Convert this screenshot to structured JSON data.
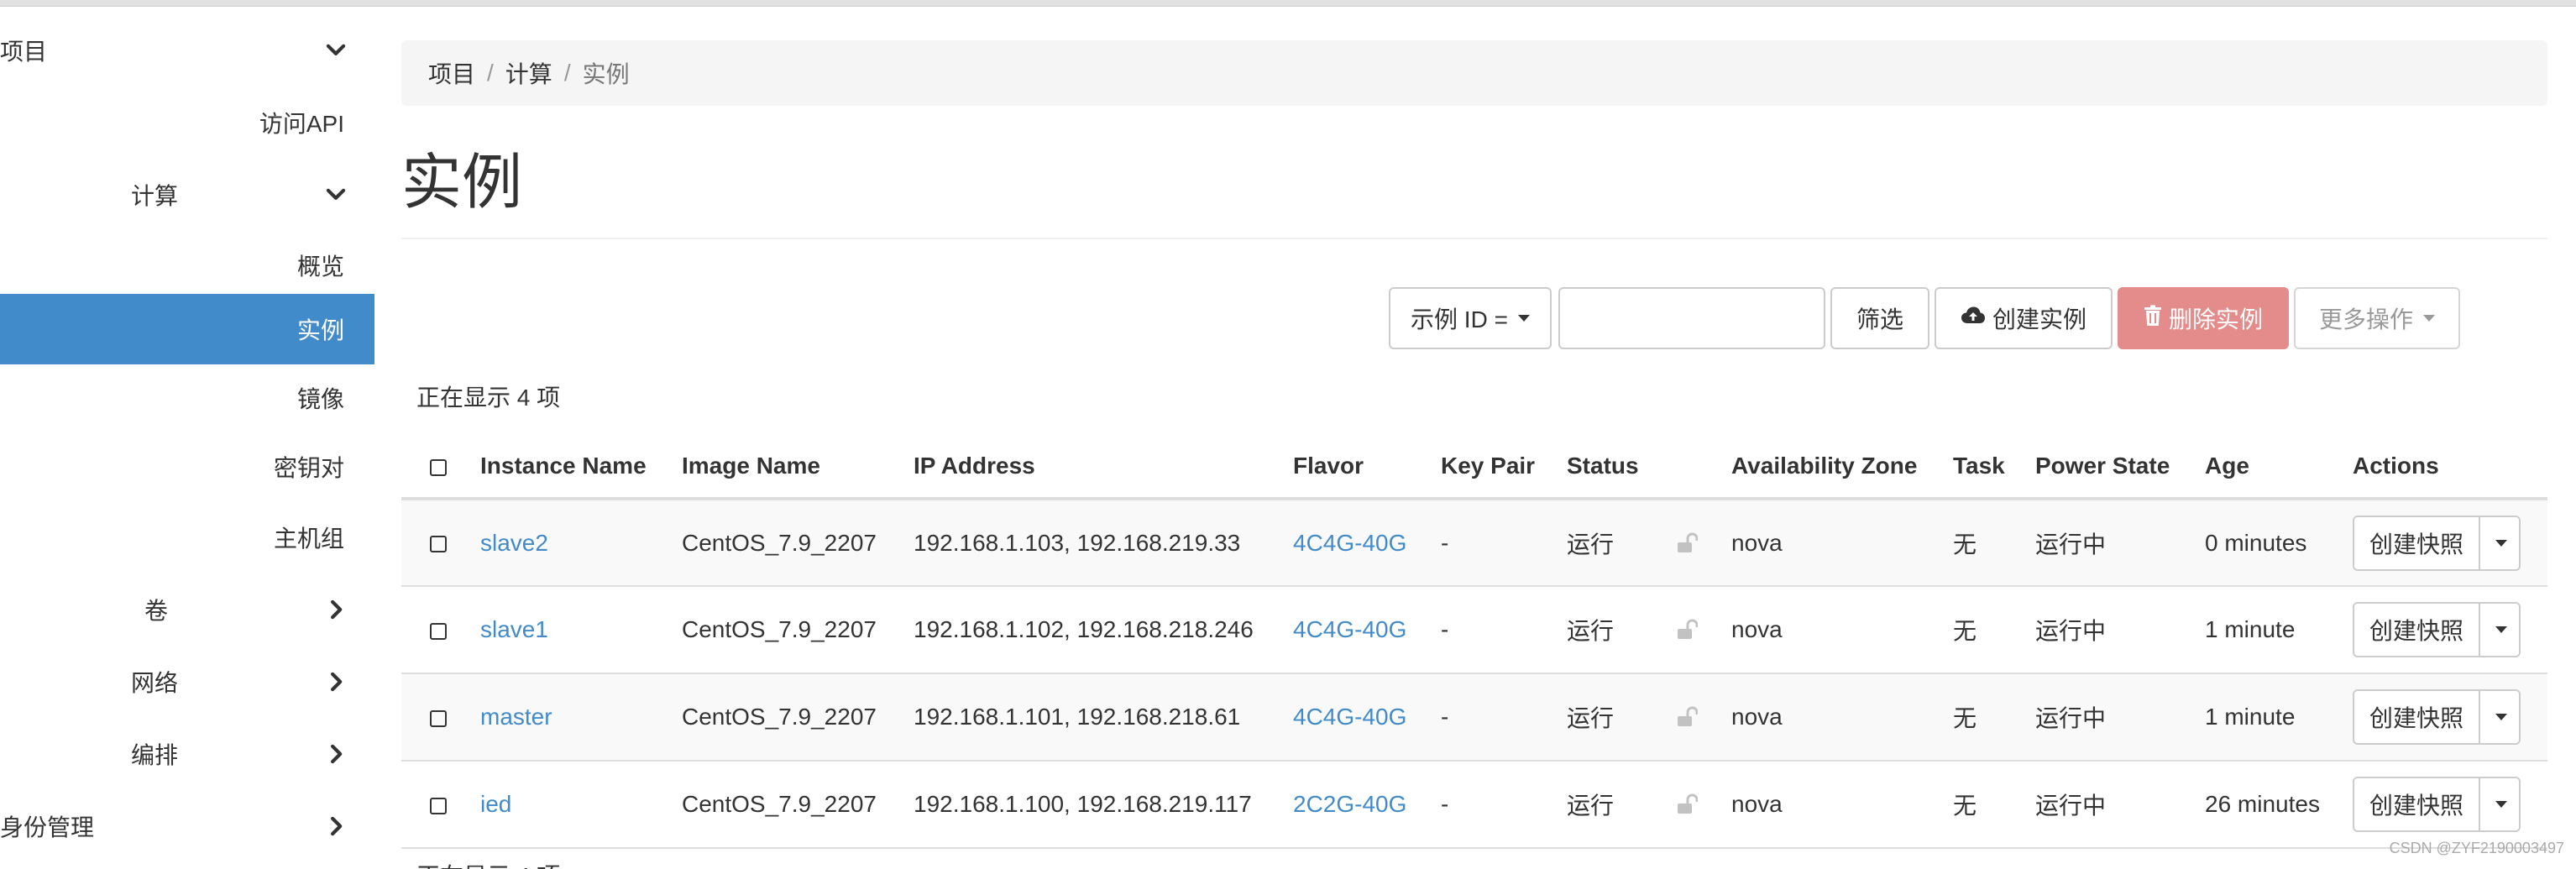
{
  "sidebar": {
    "items": [
      {
        "label": "项目",
        "icon": "chevron-down-icon"
      },
      {
        "label": "访问API"
      },
      {
        "label": "计算",
        "icon": "chevron-down-icon"
      },
      {
        "label": "概览"
      },
      {
        "label": "实例",
        "active": true
      },
      {
        "label": "镜像"
      },
      {
        "label": "密钥对"
      },
      {
        "label": "主机组"
      },
      {
        "label": "卷",
        "icon": "chevron-right-icon"
      },
      {
        "label": "网络",
        "icon": "chevron-right-icon"
      },
      {
        "label": "编排",
        "icon": "chevron-right-icon"
      },
      {
        "label": "身份管理",
        "icon": "chevron-right-icon"
      }
    ]
  },
  "breadcrumb": [
    "项目",
    "计算",
    "实例"
  ],
  "page_title": "实例",
  "toolbar": {
    "filter_select": "示例 ID =",
    "filter_value": "",
    "filter_button": "筛选",
    "create_button": "创建实例",
    "delete_button": "删除实例",
    "more_button": "更多操作"
  },
  "count_text": "正在显示 4 项",
  "table": {
    "headers": [
      "Instance Name",
      "Image Name",
      "IP Address",
      "Flavor",
      "Key Pair",
      "Status",
      "Availability Zone",
      "Task",
      "Power State",
      "Age",
      "Actions"
    ],
    "rows": [
      {
        "name": "slave2",
        "image": "CentOS_7.9_2207",
        "ip": "192.168.1.103, 192.168.219.33",
        "flavor": "4C4G-40G",
        "keypair": "-",
        "status": "运行",
        "zone": "nova",
        "task": "无",
        "power": "运行中",
        "age": "0 minutes",
        "action": "创建快照"
      },
      {
        "name": "slave1",
        "image": "CentOS_7.9_2207",
        "ip": "192.168.1.102, 192.168.218.246",
        "flavor": "4C4G-40G",
        "keypair": "-",
        "status": "运行",
        "zone": "nova",
        "task": "无",
        "power": "运行中",
        "age": "1 minute",
        "action": "创建快照"
      },
      {
        "name": "master",
        "image": "CentOS_7.9_2207",
        "ip": "192.168.1.101, 192.168.218.61",
        "flavor": "4C4G-40G",
        "keypair": "-",
        "status": "运行",
        "zone": "nova",
        "task": "无",
        "power": "运行中",
        "age": "1 minute",
        "action": "创建快照"
      },
      {
        "name": "ied",
        "image": "CentOS_7.9_2207",
        "ip": "192.168.1.100, 192.168.219.117",
        "flavor": "2C2G-40G",
        "keypair": "-",
        "status": "运行",
        "zone": "nova",
        "task": "无",
        "power": "运行中",
        "age": "26 minutes",
        "action": "创建快照"
      }
    ]
  },
  "watermark": "CSDN @ZYF2190003497",
  "colors": {
    "accent": "#428bca",
    "danger": "#e48c8b",
    "breadcrumb_bg": "#f5f5f5"
  }
}
